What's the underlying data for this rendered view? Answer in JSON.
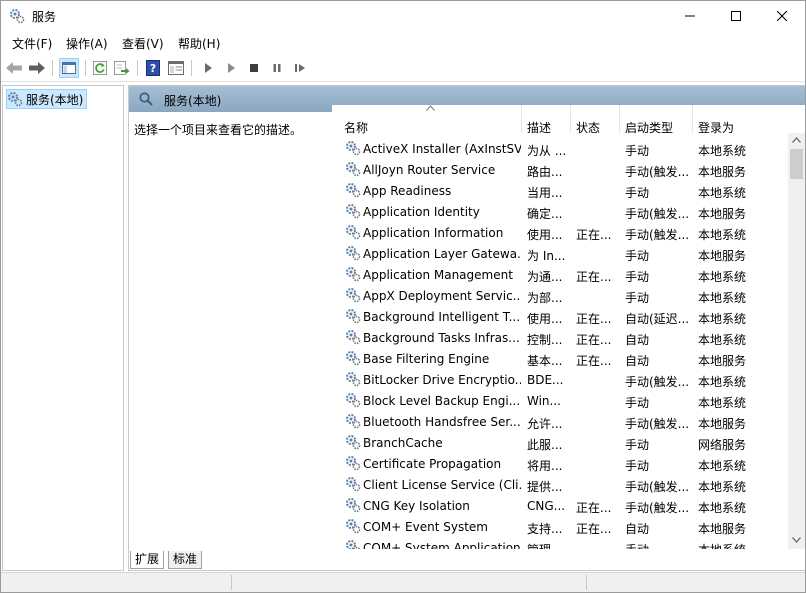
{
  "window": {
    "title": "服务"
  },
  "menu": [
    "文件(F)",
    "操作(A)",
    "查看(V)",
    "帮助(H)"
  ],
  "tree": {
    "node": "服务(本地)"
  },
  "pane": {
    "header": "服务(本地)",
    "description_hint": "选择一个项目来查看它的描述。"
  },
  "columns": [
    "名称",
    "描述",
    "状态",
    "启动类型",
    "登录为"
  ],
  "services": [
    {
      "name": "ActiveX Installer (AxInstSV)",
      "desc": "为从 ...",
      "status": "",
      "start": "手动",
      "logon": "本地系统"
    },
    {
      "name": "AllJoyn Router Service",
      "desc": "路由...",
      "status": "",
      "start": "手动(触发...",
      "logon": "本地服务"
    },
    {
      "name": "App Readiness",
      "desc": "当用...",
      "status": "",
      "start": "手动",
      "logon": "本地系统"
    },
    {
      "name": "Application Identity",
      "desc": "确定...",
      "status": "",
      "start": "手动(触发...",
      "logon": "本地服务"
    },
    {
      "name": "Application Information",
      "desc": "使用...",
      "status": "正在...",
      "start": "手动(触发...",
      "logon": "本地系统"
    },
    {
      "name": "Application Layer Gatewa...",
      "desc": "为 In...",
      "status": "",
      "start": "手动",
      "logon": "本地服务"
    },
    {
      "name": "Application Management",
      "desc": "为通...",
      "status": "正在...",
      "start": "手动",
      "logon": "本地系统"
    },
    {
      "name": "AppX Deployment Servic...",
      "desc": "为部...",
      "status": "",
      "start": "手动",
      "logon": "本地系统"
    },
    {
      "name": "Background Intelligent T...",
      "desc": "使用...",
      "status": "正在...",
      "start": "自动(延迟...",
      "logon": "本地系统"
    },
    {
      "name": "Background Tasks Infras...",
      "desc": "控制...",
      "status": "正在...",
      "start": "自动",
      "logon": "本地系统"
    },
    {
      "name": "Base Filtering Engine",
      "desc": "基本...",
      "status": "正在...",
      "start": "自动",
      "logon": "本地服务"
    },
    {
      "name": "BitLocker Drive Encryptio...",
      "desc": "BDE...",
      "status": "",
      "start": "手动(触发...",
      "logon": "本地系统"
    },
    {
      "name": "Block Level Backup Engi...",
      "desc": "Win...",
      "status": "",
      "start": "手动",
      "logon": "本地系统"
    },
    {
      "name": "Bluetooth Handsfree Ser...",
      "desc": "允许...",
      "status": "",
      "start": "手动(触发...",
      "logon": "本地服务"
    },
    {
      "name": "BranchCache",
      "desc": "此服...",
      "status": "",
      "start": "手动",
      "logon": "网络服务"
    },
    {
      "name": "Certificate Propagation",
      "desc": "将用...",
      "status": "",
      "start": "手动",
      "logon": "本地系统"
    },
    {
      "name": "Client License Service (Cli...",
      "desc": "提供...",
      "status": "",
      "start": "手动(触发...",
      "logon": "本地系统"
    },
    {
      "name": "CNG Key Isolation",
      "desc": "CNG...",
      "status": "正在...",
      "start": "手动(触发...",
      "logon": "本地系统"
    },
    {
      "name": "COM+ Event System",
      "desc": "支持...",
      "status": "正在...",
      "start": "自动",
      "logon": "本地服务"
    },
    {
      "name": "COM+ System Application",
      "desc": "管理...",
      "status": "",
      "start": "手动",
      "logon": "本地系统"
    }
  ],
  "tabs": [
    "扩展",
    "标准"
  ],
  "colors": {
    "header_grad_top": "#a7bed3",
    "header_grad_bottom": "#8aa7c1",
    "selection": "#cce8ff"
  }
}
